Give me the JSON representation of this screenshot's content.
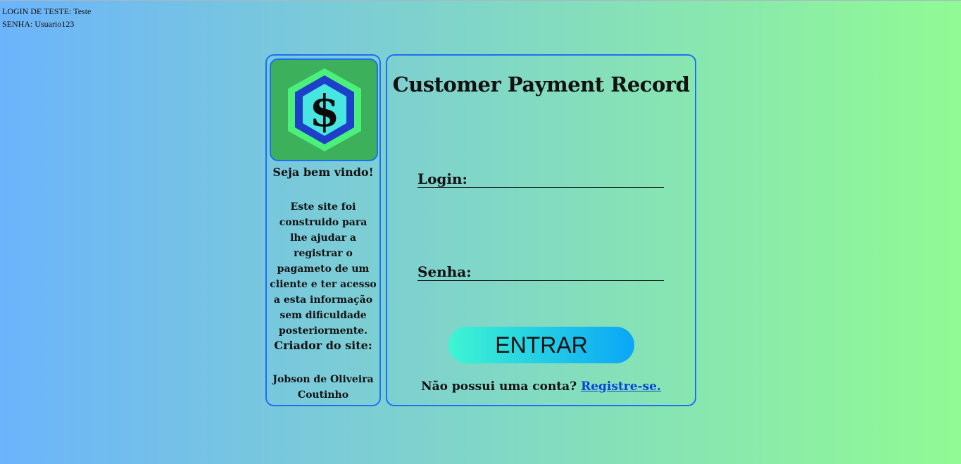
{
  "test_info": {
    "login_line": "LOGIN DE TESTE: Teste",
    "password_line": "SENHA: Usuario123"
  },
  "sidebar": {
    "logo_icon": "dollar-hexagon-icon",
    "welcome": "Seja bem vindo!",
    "description": "Este site foi construido para lhe ajudar a registrar o pagameto de um cliente e ter acesso a esta informação sem dificuldade posteriormente.",
    "creator_label": "Criador do site:",
    "creator_name": "Jobson de Oliveira Coutinho"
  },
  "login_form": {
    "title": "Customer Payment Record",
    "login_label": "Login:",
    "login_value": "",
    "password_label": "Senha:",
    "password_value": "",
    "submit_label": "ENTRAR",
    "register_prompt": "Não possui uma conta?",
    "register_link": "Registre-se."
  },
  "colors": {
    "accent_border": "#1e6ff2",
    "logo_background": "#3cb05a",
    "button_gradient_start": "#3ef5d2",
    "button_gradient_end": "#0aa6f7",
    "link": "#0645d8"
  }
}
